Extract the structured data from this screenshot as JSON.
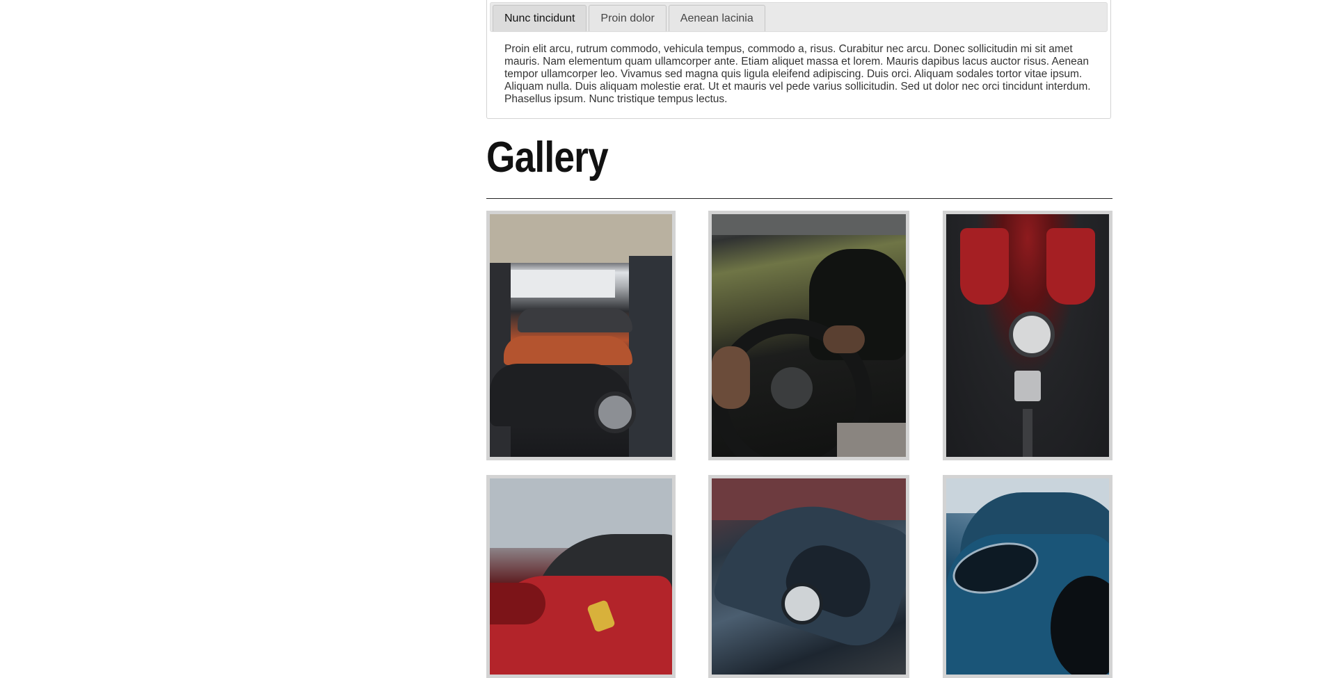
{
  "tabs": {
    "items": [
      {
        "label": "Nunc tincidunt",
        "active": true
      },
      {
        "label": "Proin dolor",
        "active": false
      },
      {
        "label": "Aenean lacinia",
        "active": false
      }
    ],
    "panel_text": "Proin elit arcu, rutrum commodo, vehicula tempus, commodo a, risus. Curabitur nec arcu. Donec sollicitudin mi sit amet mauris. Nam elementum quam ullamcorper ante. Etiam aliquet massa et lorem. Mauris dapibus lacus auctor risus. Aenean tempor ullamcorper leo. Vivamus sed magna quis ligula eleifend adipiscing. Duis orci. Aliquam sodales tortor vitae ipsum. Aliquam nulla. Duis aliquam molestie erat. Ut et mauris vel pede varius sollicitudin. Sed ut dolor nec orci tincidunt interdum. Phasellus ipsum. Nunc tristique tempus lectus."
  },
  "gallery": {
    "title": "Gallery",
    "photos": [
      {
        "subject": "cars-in-garage"
      },
      {
        "subject": "driver-at-wheel"
      },
      {
        "subject": "ferrari-engine"
      },
      {
        "subject": "red-ferrari-side"
      },
      {
        "subject": "dark-sports-car"
      },
      {
        "subject": "blue-porsche"
      }
    ]
  },
  "colors": {
    "tab_bar_bg": "#e9e9e9",
    "active_tab_bg": "#dcdcdc",
    "photo_border": "#d3d3d3"
  }
}
